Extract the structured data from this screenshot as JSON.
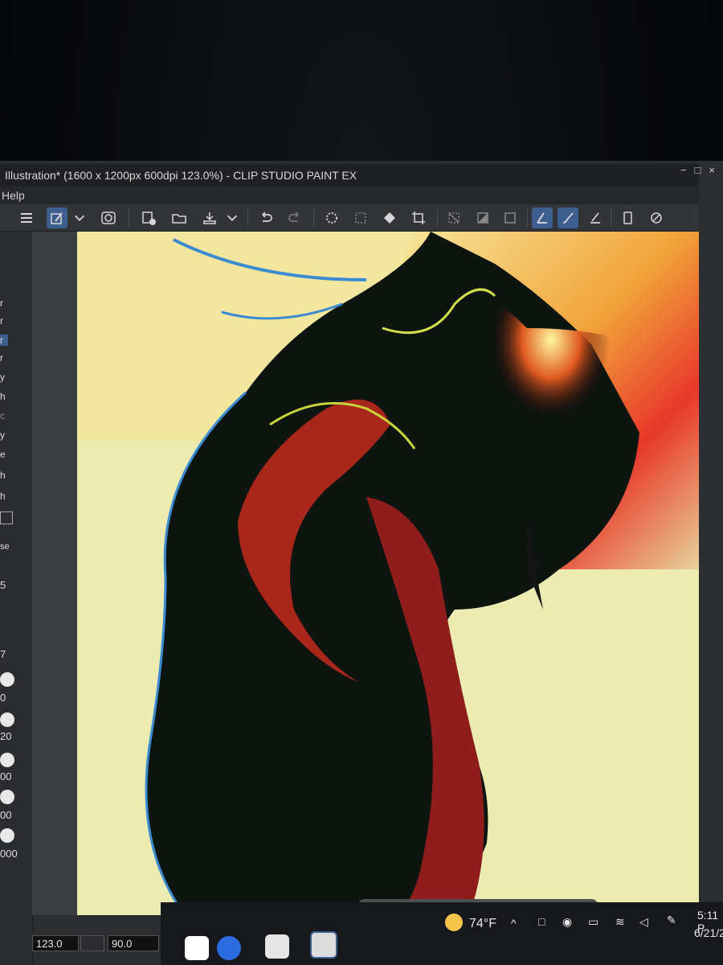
{
  "window": {
    "title": "Illustration* (1600 x 1200px 600dpi 123.0%)  - CLIP STUDIO PAINT EX",
    "controls": [
      "−",
      "□",
      "×"
    ]
  },
  "menubar": {
    "help": "Help"
  },
  "toolbar": {
    "items": [
      "menu-icon",
      "pen-settings-icon",
      "chevron-down-icon",
      "spiral-icon",
      "new-canvas-icon",
      "open-folder-icon",
      "save-icon",
      "chevron-down-icon",
      "undo-icon",
      "redo-icon",
      "loading-icon",
      "transform-icon",
      "fill-icon",
      "crop-icon",
      "deselect-icon",
      "invert-selection-icon",
      "selection-border-icon",
      "pen-pressure-icon",
      "brush-icon",
      "eraser-icon",
      "phone-icon",
      "link-icon"
    ]
  },
  "left_panel": {
    "labels": [
      "r",
      "r",
      "r",
      "r",
      "y",
      "h",
      "c",
      "y",
      "e",
      "h",
      "h"
    ],
    "panel_label": "se",
    "values": [
      "5",
      "7",
      "0",
      "20",
      "00",
      "00",
      "000"
    ]
  },
  "statusbar": {
    "zoom": "123.0",
    "rotation": "90.0"
  },
  "taskbar": {
    "weather_temp": "74°F",
    "time": "5:11 P",
    "date": "6/21/2"
  },
  "colors": {
    "toolbar_active": "#3c5f8f",
    "app_bg": "#2b2d31"
  }
}
